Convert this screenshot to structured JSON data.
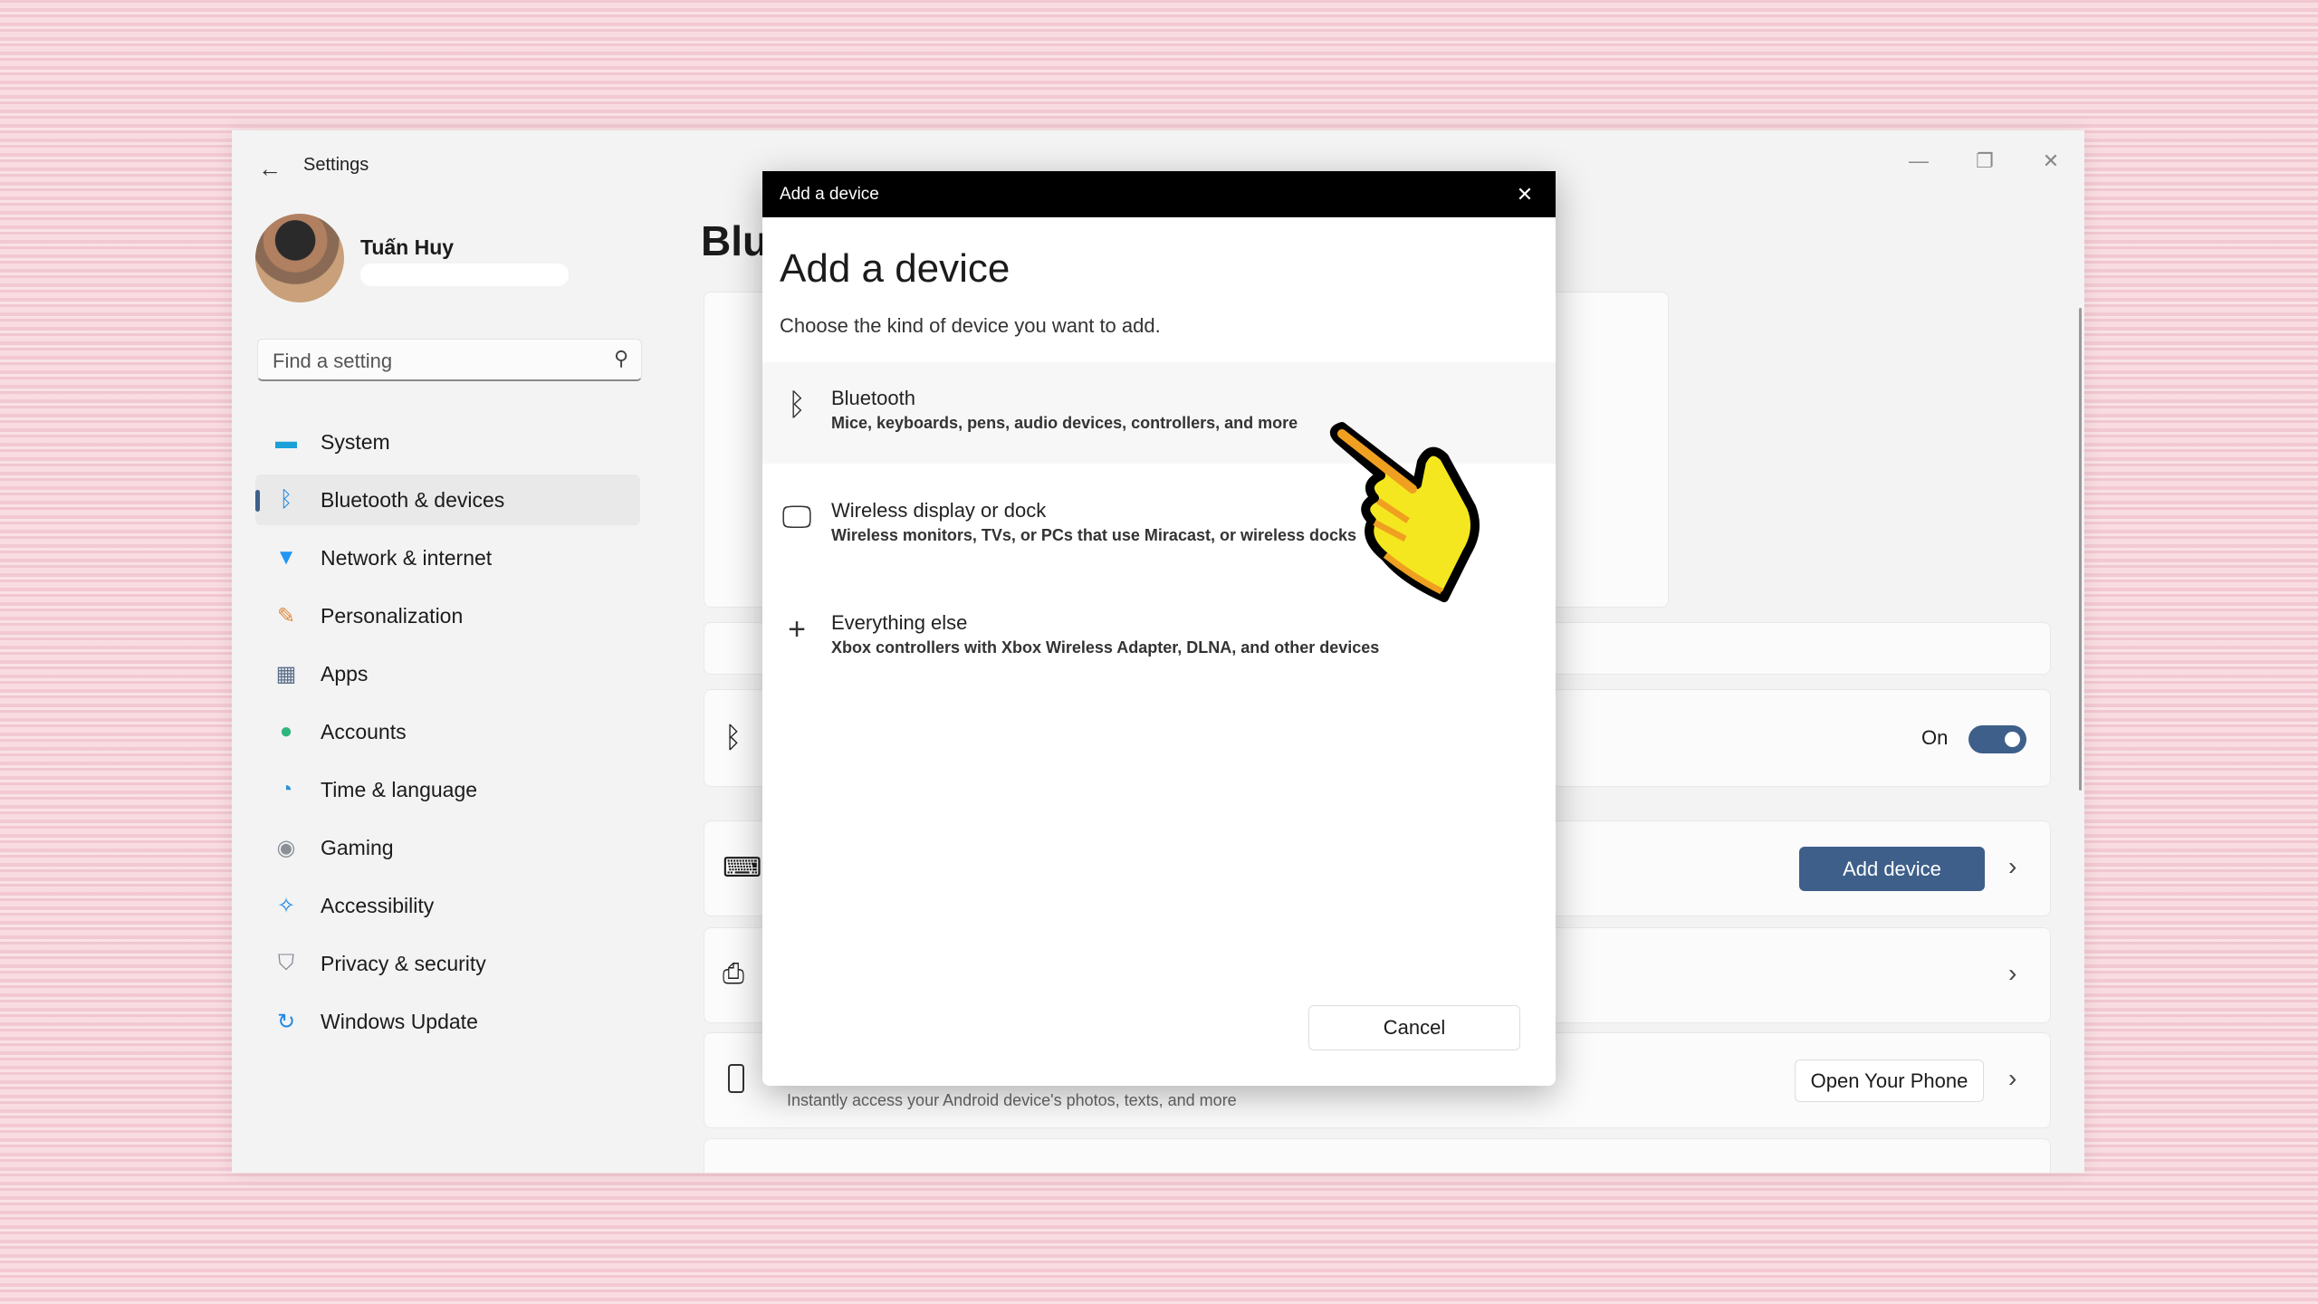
{
  "window": {
    "title": "Settings",
    "controls": [
      "minimize",
      "maximize",
      "close"
    ]
  },
  "user": {
    "name": "Tuấn Huy"
  },
  "search": {
    "placeholder": "Find a setting"
  },
  "sidebar": {
    "items": [
      {
        "label": "System",
        "icon": "monitor-icon",
        "color": "#1aa0d8"
      },
      {
        "label": "Bluetooth & devices",
        "icon": "bluetooth-icon",
        "color": "#1e88e5",
        "active": true
      },
      {
        "label": "Network & internet",
        "icon": "wifi-icon",
        "color": "#2196f3"
      },
      {
        "label": "Personalization",
        "icon": "brush-icon",
        "color": "#e08a3c"
      },
      {
        "label": "Apps",
        "icon": "apps-icon",
        "color": "#5b6f8a"
      },
      {
        "label": "Accounts",
        "icon": "person-icon",
        "color": "#2fb67c"
      },
      {
        "label": "Time & language",
        "icon": "globe-icon",
        "color": "#2a8fd8"
      },
      {
        "label": "Gaming",
        "icon": "gamepad-icon",
        "color": "#8a8f98"
      },
      {
        "label": "Accessibility",
        "icon": "accessibility-icon",
        "color": "#1e88e5"
      },
      {
        "label": "Privacy & security",
        "icon": "shield-icon",
        "color": "#7f8690"
      },
      {
        "label": "Windows Update",
        "icon": "update-icon",
        "color": "#1e88e5"
      }
    ]
  },
  "main": {
    "title_partial": "Blu",
    "bluetooth_toggle": {
      "label": "On",
      "value": true
    },
    "add_device_button": "Add device",
    "phone_description": "Instantly access your Android device's photos, texts, and more",
    "open_phone_button": "Open Your Phone",
    "accent": "#3e5f8a"
  },
  "dialog": {
    "titlebar": "Add a device",
    "heading": "Add a device",
    "subtitle": "Choose the kind of device you want to add.",
    "options": [
      {
        "title": "Bluetooth",
        "description": "Mice, keyboards, pens, audio devices, controllers, and more",
        "icon": "bluetooth-icon"
      },
      {
        "title": "Wireless display or dock",
        "description": "Wireless monitors, TVs, or PCs that use Miracast, or wireless docks",
        "icon": "monitor-icon"
      },
      {
        "title": "Everything else",
        "description": "Xbox controllers with Xbox Wireless Adapter, DLNA, and other devices",
        "icon": "plus-icon"
      }
    ],
    "cancel": "Cancel"
  }
}
